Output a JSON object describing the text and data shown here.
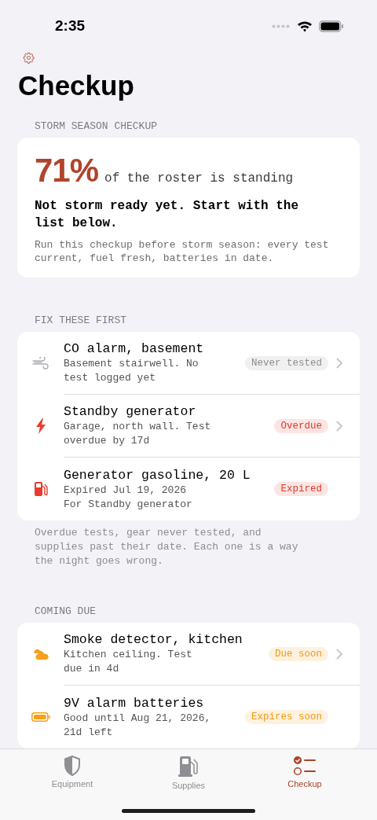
{
  "status_bar": {
    "time": "2:35"
  },
  "title": "Checkup",
  "summary": {
    "header": "STORM SEASON CHECKUP",
    "percent": "71%",
    "percent_caption": "of the roster is standing",
    "headline": "Not storm ready yet. Start with the list below.",
    "note": "Run this checkup before storm season: every test current, fuel fresh, batteries in date."
  },
  "sections": [
    {
      "header": "FIX THESE FIRST",
      "items": [
        {
          "kind": "wind",
          "title": "CO alarm, basement",
          "lines": [
            "Basement stairwell. No test logged yet"
          ],
          "badge": "Never tested",
          "color": "#8e8e93",
          "chevron": true
        },
        {
          "kind": "bolt",
          "title": "Standby generator",
          "lines": [
            "Garage, north wall. Test overdue by 17d"
          ],
          "badge": "Overdue",
          "color": "#e0392c",
          "chevron": true
        },
        {
          "kind": "fuel",
          "title": "Generator gasoline, 20 L",
          "lines": [
            "Expired Jul 19, 2026",
            "For Standby generator"
          ],
          "badge": "Expired",
          "color": "#e0392c",
          "chevron": false
        }
      ],
      "footer": "Overdue tests, gear never tested, and supplies past their date. Each one is a way the night goes wrong."
    },
    {
      "header": "COMING DUE",
      "items": [
        {
          "kind": "cloud",
          "title": "Smoke detector, kitchen",
          "lines": [
            "Kitchen ceiling. Test due in 4d"
          ],
          "badge": "Due soon",
          "color": "#f09a12",
          "chevron": true
        },
        {
          "kind": "battery",
          "title": "9V alarm batteries",
          "lines": [
            "Good until Aug 21, 2026, 21d left"
          ],
          "badge": "Expires soon",
          "color": "#f09a12",
          "chevron": false
        }
      ]
    }
  ],
  "tabs": [
    {
      "kind": "shield",
      "label": "Equipment",
      "selected": false
    },
    {
      "kind": "pump",
      "label": "Supplies",
      "selected": false
    },
    {
      "kind": "checklist",
      "label": "Checkup",
      "selected": true
    }
  ]
}
